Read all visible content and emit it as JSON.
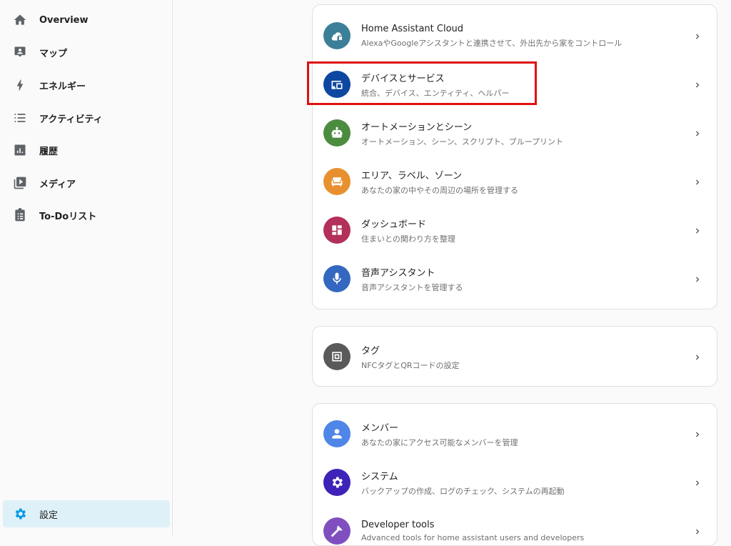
{
  "sidebar": {
    "items": [
      {
        "label": "Overview",
        "icon": "home-icon"
      },
      {
        "label": "マップ",
        "icon": "map-icon"
      },
      {
        "label": "エネルギー",
        "icon": "lightning-icon"
      },
      {
        "label": "アクティビティ",
        "icon": "list-icon"
      },
      {
        "label": "履歴",
        "icon": "chart-icon"
      },
      {
        "label": "メディア",
        "icon": "media-icon"
      },
      {
        "label": "To-Doリスト",
        "icon": "clipboard-icon"
      }
    ],
    "settings_label": "設定"
  },
  "cards": [
    {
      "rows": [
        {
          "title": "Home Assistant Cloud",
          "subtitle": "AlexaやGoogleアシスタントと連携させて、外出先から家をコントロール",
          "color": "#3c7f98",
          "icon": "cloud-lock-icon"
        },
        {
          "title": "デバイスとサービス",
          "subtitle": "統合、デバイス、エンティティ、ヘルパー",
          "color": "#0d47a1",
          "icon": "devices-icon"
        },
        {
          "title": "オートメーションとシーン",
          "subtitle": "オートメーション、シーン、スクリプト、ブループリント",
          "color": "#4c8c3f",
          "icon": "robot-icon"
        },
        {
          "title": "エリア、ラベル、ゾーン",
          "subtitle": "あなたの家の中やその周辺の場所を管理する",
          "color": "#e8902f",
          "icon": "sofa-icon"
        },
        {
          "title": "ダッシュボード",
          "subtitle": "住まいとの関わり方を整理",
          "color": "#b3305a",
          "icon": "dashboard-icon"
        },
        {
          "title": "音声アシスタント",
          "subtitle": "音声アシスタントを管理する",
          "color": "#3468c0",
          "icon": "microphone-icon"
        }
      ]
    },
    {
      "rows": [
        {
          "title": "タグ",
          "subtitle": "NFCタグとQRコードの設定",
          "color": "#5a5a5a",
          "icon": "nfc-icon"
        }
      ]
    },
    {
      "rows": [
        {
          "title": "メンバー",
          "subtitle": "あなたの家にアクセス可能なメンバーを管理",
          "color": "#4f86e8",
          "icon": "person-icon"
        },
        {
          "title": "システム",
          "subtitle": "バックアップの作成、ログのチェック、システムの再起動",
          "color": "#3f22b8",
          "icon": "gear-icon"
        },
        {
          "title": "Developer tools",
          "subtitle": "Advanced tools for home assistant users and developers",
          "color": "#7f4fbf",
          "icon": "hammer-icon"
        }
      ]
    }
  ]
}
